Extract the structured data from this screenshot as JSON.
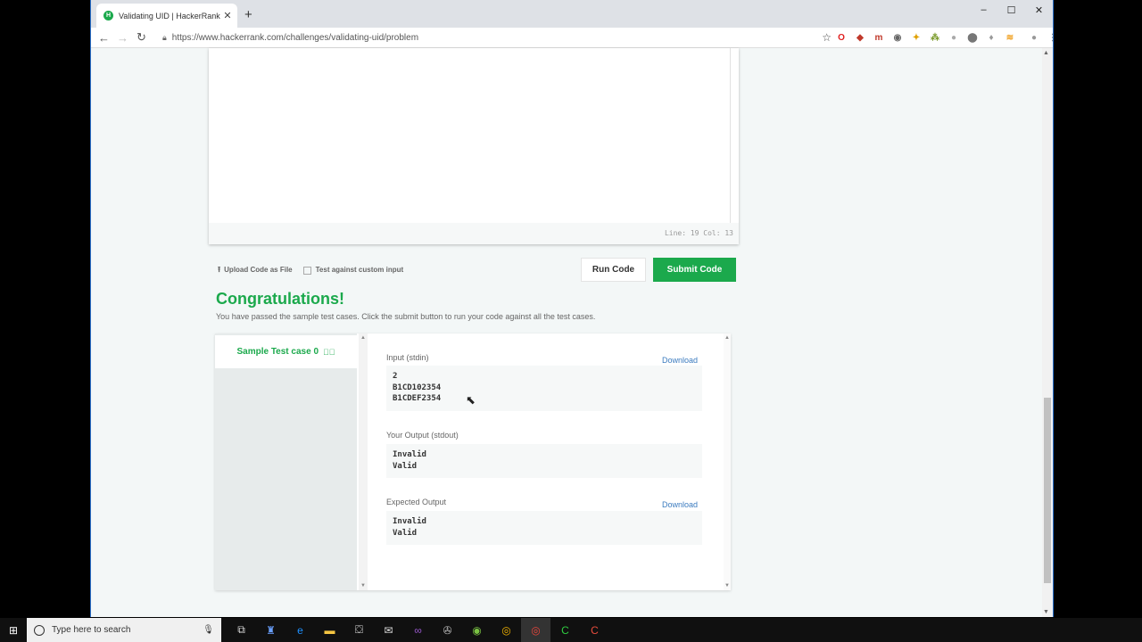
{
  "browser": {
    "tab_title": "Validating UID | HackerRank",
    "tab_favicon": "H",
    "new_tab": "+",
    "url": "https://www.hackerrank.com/challenges/validating-uid/problem",
    "window_controls": [
      "–",
      "☐",
      "✕"
    ]
  },
  "editor": {
    "status": "Line: 19  Col: 13"
  },
  "actions": {
    "upload_label": "Upload Code as File",
    "custom_input_label": "Test against custom input",
    "run_label": "Run Code",
    "submit_label": "Submit Code"
  },
  "result": {
    "title": "Congratulations!",
    "message": "You have passed the sample test cases. Click the submit button to run your code against all the test cases.",
    "test_case_label": "Sample Test case 0",
    "input_label": "Input (stdin)",
    "input_download": "Download",
    "input_lines": [
      "2",
      "B1CD102354",
      "B1CDEF2354"
    ],
    "your_output_label": "Your Output (stdout)",
    "your_output_lines": [
      "Invalid",
      "Valid"
    ],
    "expected_label": "Expected Output",
    "expected_download": "Download",
    "expected_lines": [
      "Invalid",
      "Valid"
    ]
  },
  "taskbar": {
    "search_placeholder": "Type here to search"
  },
  "colors": {
    "brand_green": "#1ba94c",
    "link_blue": "#3b7bbf"
  }
}
